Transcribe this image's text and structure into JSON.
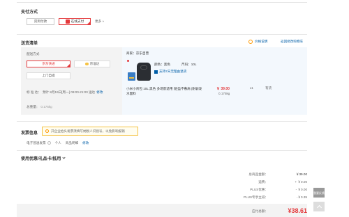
{
  "payment": {
    "title": "支付方式",
    "options": [
      "货到付款",
      "在线支付"
    ],
    "more": "更多 »"
  },
  "delivery": {
    "title": "送货清单",
    "price_note": "价格说明",
    "back_cart": "返回修改购物车",
    "method_label": "配送方式",
    "methods": [
      "京东快递",
      "京准达",
      "上门自提"
    ],
    "ship_time_label": "标 准 达：",
    "ship_time": "预计 8月19日[周一] 09:00-21:00 送达",
    "ship_time_edit": "修改",
    "weight_label": "总重量：",
    "weight": "0.175kg"
  },
  "product": {
    "seller_label": "商家：",
    "seller": "京东自营",
    "color_label": "颜色：",
    "color": "黑色",
    "size_label": "尺码：",
    "size": "10L",
    "service": "支持7天无理由退货",
    "name": "小米小背包 10L 黑色 多场景适用 |轻盈不敷肩 |耐弱泼水面料",
    "price": "￥ 39.00",
    "weight": "0.175kg",
    "qty": "x1",
    "stock": "有货"
  },
  "invoice": {
    "title": "发票信息",
    "notice": "开企业抬头发票须填写纳税人识别号，以免影响报销",
    "type": "电子普通发票",
    "person": "个人",
    "content": "商品明细",
    "edit": "修改"
  },
  "coupon": {
    "title": "使用优惠/礼品卡/抵用"
  },
  "summary": {
    "rows": [
      {
        "label": "总商品金额：",
        "value": "￥39.00"
      },
      {
        "label": "运费：",
        "value": "+ ￥0.00"
      },
      {
        "label": "PLUS优惠：",
        "value": "- ￥0.00"
      },
      {
        "label": "PLUS专享立减：",
        "value": "-￥0.39"
      }
    ],
    "payable_label": "应付总额：",
    "payable": "¥38.61"
  },
  "side": {
    "survey": "我要反馈"
  },
  "colors": {
    "accent": "#e4393c",
    "link": "#005ea7",
    "product_bg": "#f3f8fd"
  }
}
